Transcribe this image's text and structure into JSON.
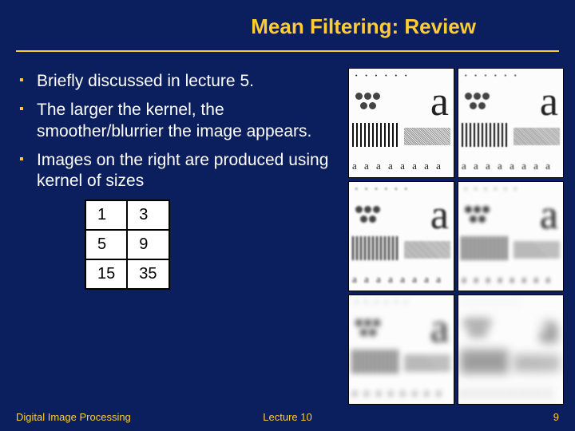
{
  "title": "Mean Filtering: Review",
  "bullets": [
    "Briefly discussed in lecture 5.",
    "The larger the kernel, the smoother/blurrier the image appears.",
    "Images on the right are produced using kernel of sizes"
  ],
  "kernel_table": [
    [
      "1",
      "3"
    ],
    [
      "5",
      "9"
    ],
    [
      "15",
      "35"
    ]
  ],
  "thumb_glyph": "a",
  "thumb_small_glyphs": "a a a a a a a a",
  "thumb_dots": "• • • • • • • • • •",
  "footer": {
    "left": "Digital Image Processing",
    "center": "Lecture 10",
    "right": "9"
  }
}
